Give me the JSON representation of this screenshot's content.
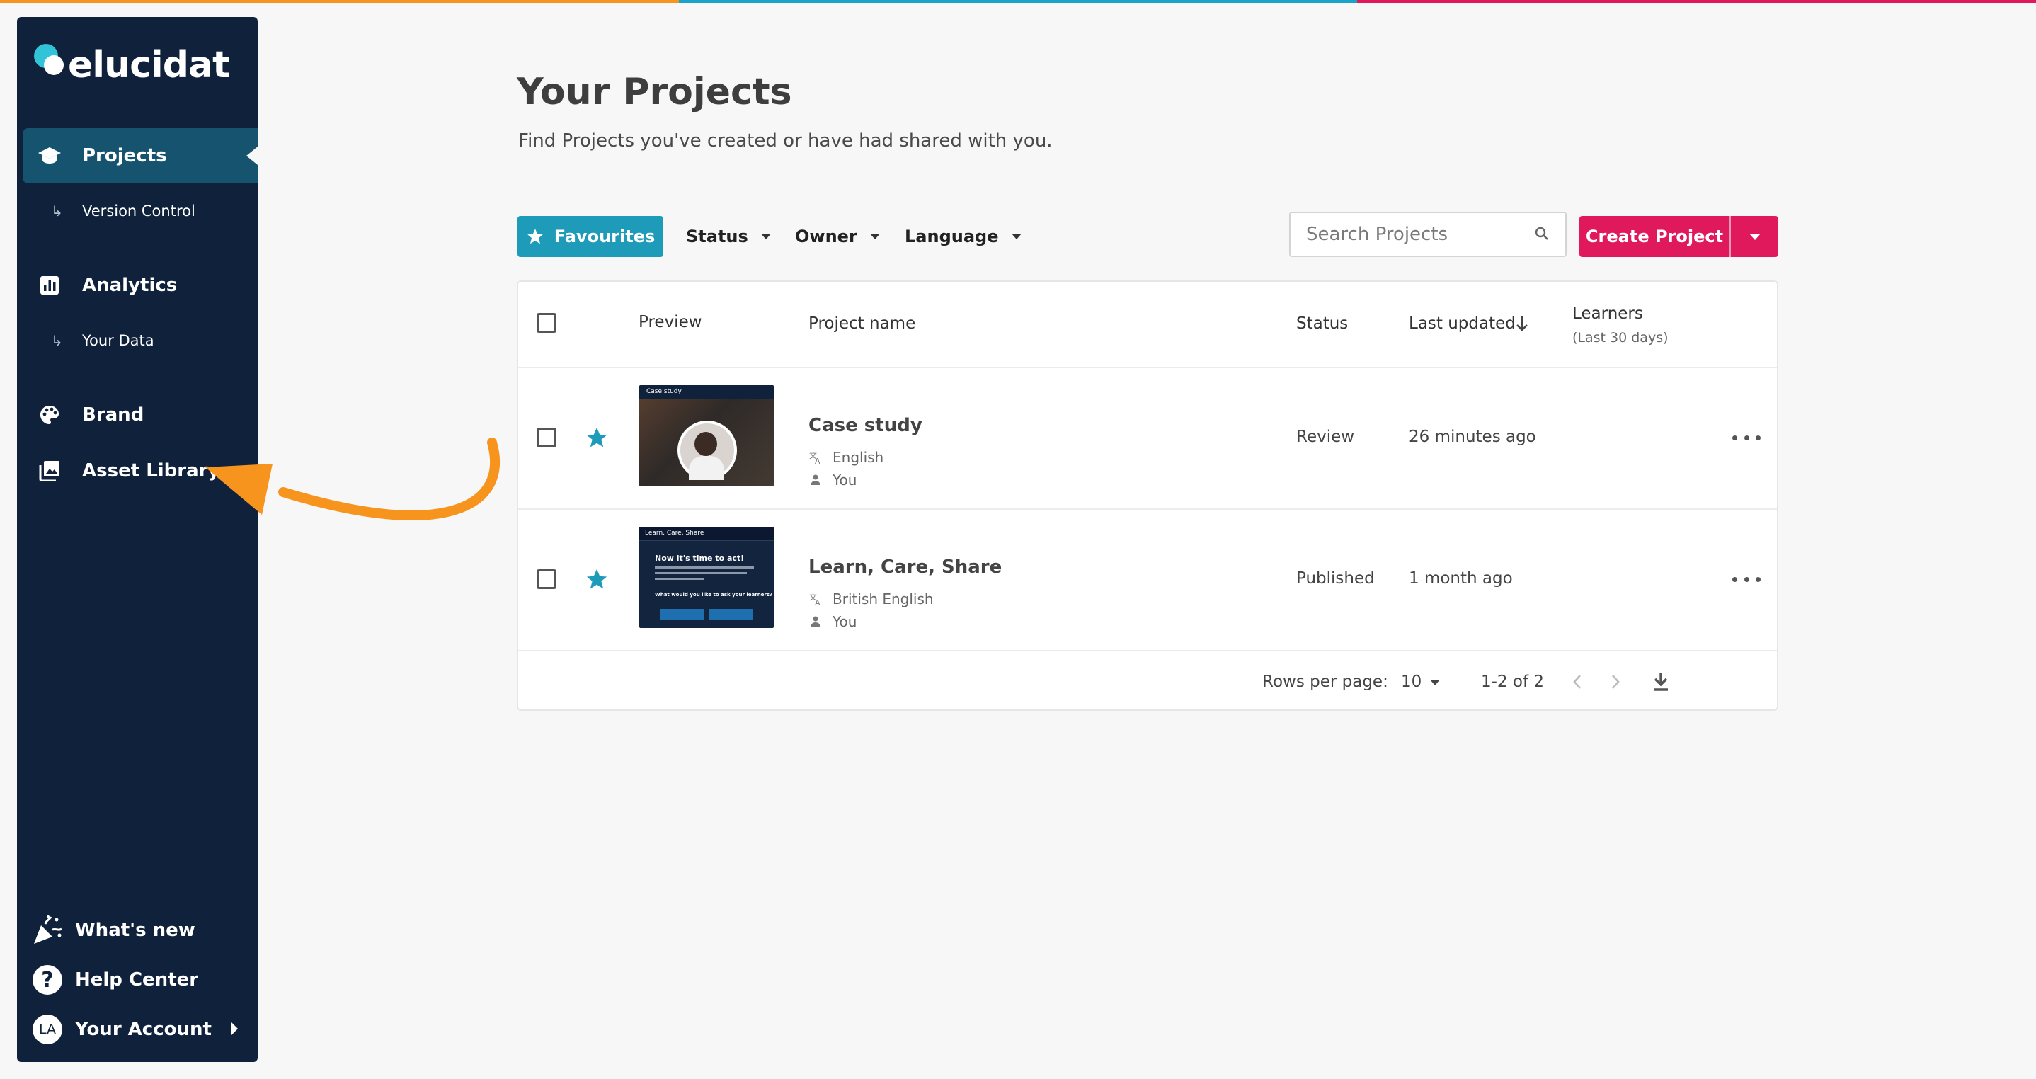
{
  "colors": {
    "sidebar_bg": "#10213b",
    "active_nav": "#16536f",
    "accent_teal": "#1e9bb8",
    "create_pink": "#e0195d",
    "annotation_arrow": "#f7941d",
    "top_stripe": [
      "#f7941d",
      "#1aa3c9",
      "#e0195d"
    ]
  },
  "brand": {
    "logo_text": "elucidat"
  },
  "sidebar": {
    "items": [
      {
        "label": "Projects",
        "icon": "graduation-cap-icon",
        "active": true
      },
      {
        "label": "Version Control",
        "icon": "sub-arrow-icon",
        "sub": true
      },
      {
        "label": "Analytics",
        "icon": "bar-chart-icon"
      },
      {
        "label": "Your Data",
        "icon": "sub-arrow-icon",
        "sub": true
      },
      {
        "label": "Brand",
        "icon": "palette-icon"
      },
      {
        "label": "Asset Library",
        "icon": "image-library-icon"
      }
    ],
    "sub_arrow": "↳",
    "footer": [
      {
        "label": "What's new",
        "icon": "party-popper-icon"
      },
      {
        "label": "Help Center",
        "icon": "question-circle-icon",
        "glyph": "?"
      },
      {
        "label": "Your Account",
        "icon": "avatar",
        "initials": "LA"
      }
    ]
  },
  "main": {
    "title": "Your Projects",
    "subtitle": "Find Projects you've created or have had shared with you.",
    "toolbar": {
      "favourites_label": "Favourites",
      "filters": [
        "Status",
        "Owner",
        "Language"
      ],
      "search_placeholder": "Search Projects",
      "create_label": "Create Project"
    },
    "table": {
      "headers": {
        "preview": "Preview",
        "project_name": "Project name",
        "status": "Status",
        "last_updated": "Last updated",
        "learners": "Learners",
        "learners_sub": "(Last 30 days)"
      },
      "rows": [
        {
          "name": "Case study",
          "language": "English",
          "owner": "You",
          "status": "Review",
          "last_updated": "26 minutes ago",
          "favourite": true,
          "thumb_title": "Case study"
        },
        {
          "name": "Learn, Care, Share",
          "language": "British English",
          "owner": "You",
          "status": "Published",
          "last_updated": "1 month ago",
          "favourite": true,
          "thumb_title": "Learn, Care, Share",
          "thumb_heading": "Now it's time to act!",
          "thumb_question": "What would you like to ask your learners?"
        }
      ],
      "footer": {
        "rows_per_page_label": "Rows per page:",
        "rows_per_page_value": "10",
        "range": "1-2 of 2"
      }
    }
  }
}
